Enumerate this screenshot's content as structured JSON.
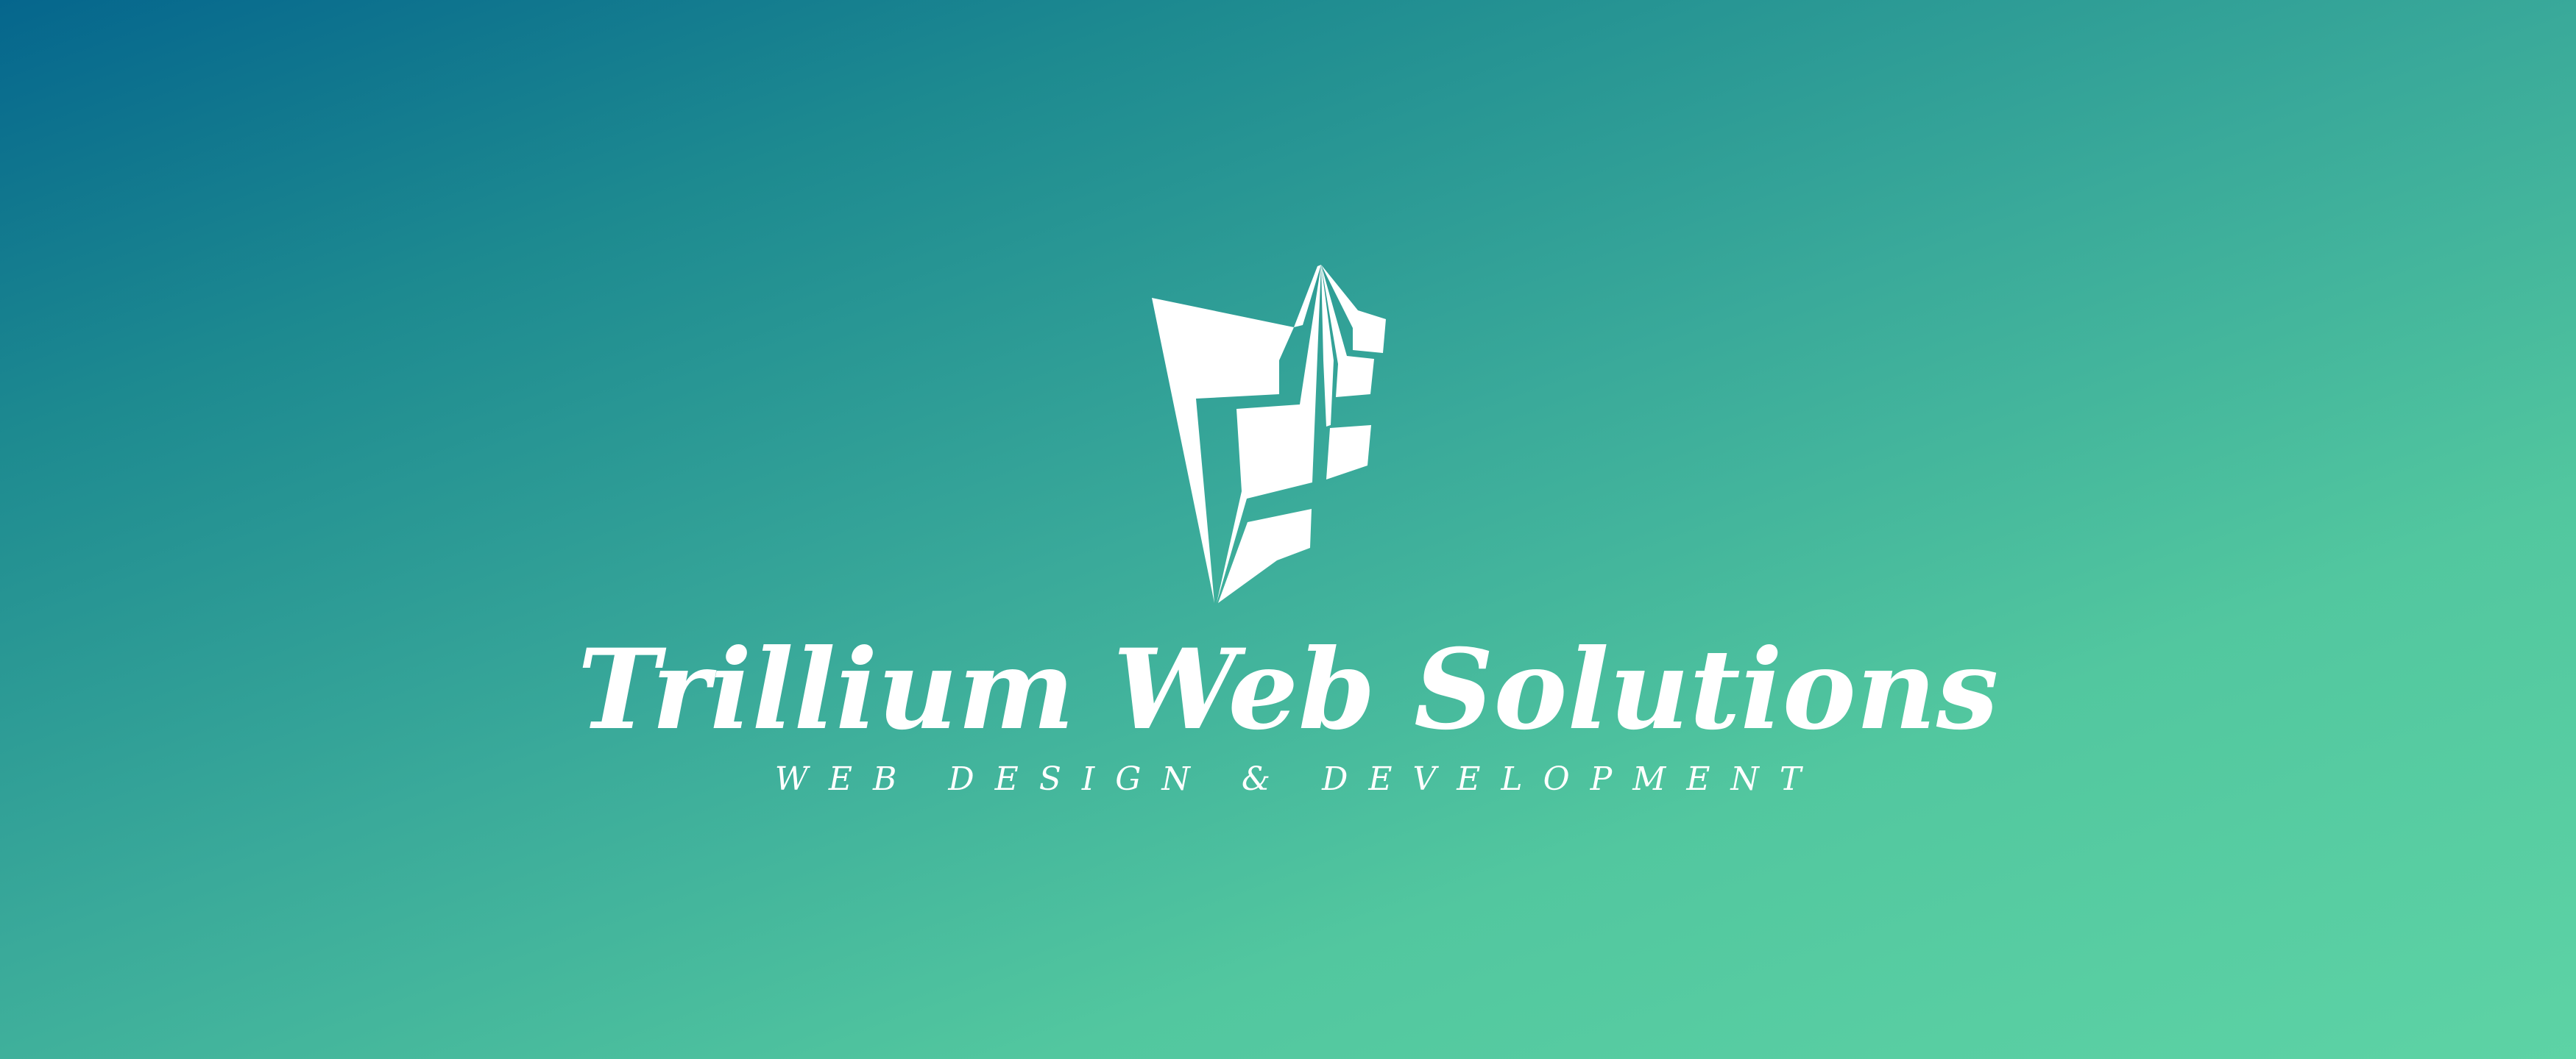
{
  "brand": {
    "name": "Trillium Web Solutions",
    "tagline": "WEB DESIGN & DEVELOPMENT",
    "logo_icon": "trillium-logo-icon"
  },
  "colors": {
    "gradient_start": "#05668d",
    "gradient_end": "#5dd3a5",
    "foreground": "#ffffff"
  }
}
